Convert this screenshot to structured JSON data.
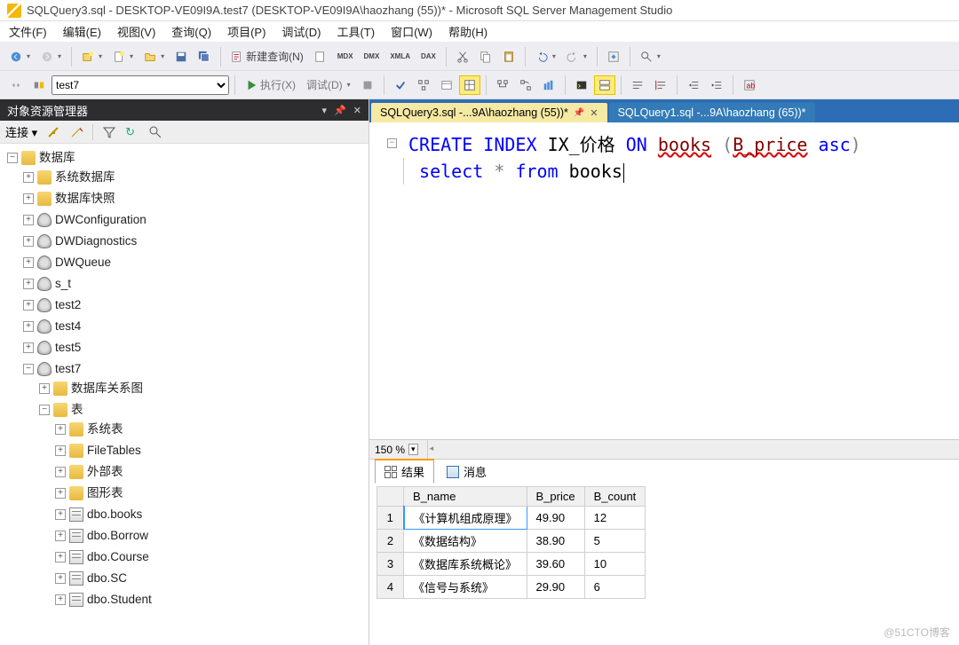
{
  "window": {
    "title": "SQLQuery3.sql - DESKTOP-VE09I9A.test7 (DESKTOP-VE09I9A\\haozhang (55))* - Microsoft SQL Server Management Studio"
  },
  "menubar": [
    "文件(F)",
    "编辑(E)",
    "视图(V)",
    "查询(Q)",
    "项目(P)",
    "调试(D)",
    "工具(T)",
    "窗口(W)",
    "帮助(H)"
  ],
  "toolbar1": {
    "new_query": "新建查询(N)"
  },
  "toolbar2": {
    "db_selector": "test7",
    "execute": "执行(X)",
    "debug": "调试(D)"
  },
  "sidebar": {
    "title": "对象资源管理器",
    "connect_label": "连接",
    "tree": {
      "root": "数据库",
      "children": [
        {
          "icon": "folder",
          "label": "系统数据库",
          "tw": "+"
        },
        {
          "icon": "folder",
          "label": "数据库快照",
          "tw": "+"
        },
        {
          "icon": "db",
          "label": "DWConfiguration",
          "tw": "+"
        },
        {
          "icon": "db",
          "label": "DWDiagnostics",
          "tw": "+"
        },
        {
          "icon": "db",
          "label": "DWQueue",
          "tw": "+"
        },
        {
          "icon": "db",
          "label": "s_t",
          "tw": "+"
        },
        {
          "icon": "db",
          "label": "test2",
          "tw": "+"
        },
        {
          "icon": "db",
          "label": "test4",
          "tw": "+"
        },
        {
          "icon": "db",
          "label": "test5",
          "tw": "+"
        },
        {
          "icon": "db",
          "label": "test7",
          "tw": "-",
          "children": [
            {
              "icon": "folder",
              "label": "数据库关系图",
              "tw": "+"
            },
            {
              "icon": "folder",
              "label": "表",
              "tw": "-",
              "children": [
                {
                  "icon": "folder",
                  "label": "系统表",
                  "tw": "+"
                },
                {
                  "icon": "folder",
                  "label": "FileTables",
                  "tw": "+"
                },
                {
                  "icon": "folder",
                  "label": "外部表",
                  "tw": "+"
                },
                {
                  "icon": "folder",
                  "label": "图形表",
                  "tw": "+"
                },
                {
                  "icon": "tbl",
                  "label": "dbo.books",
                  "tw": "+"
                },
                {
                  "icon": "tbl",
                  "label": "dbo.Borrow",
                  "tw": "+"
                },
                {
                  "icon": "tbl",
                  "label": "dbo.Course",
                  "tw": "+"
                },
                {
                  "icon": "tbl",
                  "label": "dbo.SC",
                  "tw": "+"
                },
                {
                  "icon": "tbl",
                  "label": "dbo.Student",
                  "tw": "+"
                }
              ]
            }
          ]
        }
      ]
    }
  },
  "editor": {
    "tabs": [
      {
        "label": "SQLQuery3.sql -...9A\\haozhang (55))*",
        "active": true
      },
      {
        "label": "SQLQuery1.sql -...9A\\haozhang (65))*",
        "active": false
      }
    ],
    "zoom": "150 %",
    "code": {
      "line1": {
        "p1": "CREATE",
        "p2": "INDEX",
        "p3": "IX_价格",
        "p4": "ON",
        "p5": "books",
        "p6": "(",
        "p7": "B_price",
        "p8": "asc",
        "p9": ")"
      },
      "line2": {
        "p1": "select",
        "p2": "*",
        "p3": "from",
        "p4": "books"
      }
    }
  },
  "result_tabs": {
    "results": "结果",
    "messages": "消息"
  },
  "chart_data": {
    "type": "table",
    "columns": [
      "B_name",
      "B_price",
      "B_count"
    ],
    "rows": [
      {
        "n": 1,
        "B_name": "《计算机组成原理》",
        "B_price": "49.90",
        "B_count": "12"
      },
      {
        "n": 2,
        "B_name": "《数据结构》",
        "B_price": "38.90",
        "B_count": "5"
      },
      {
        "n": 3,
        "B_name": "《数据库系统概论》",
        "B_price": "39.60",
        "B_count": "10"
      },
      {
        "n": 4,
        "B_name": "《信号与系统》",
        "B_price": "29.90",
        "B_count": "6"
      }
    ]
  },
  "watermark": "@51CTO博客"
}
